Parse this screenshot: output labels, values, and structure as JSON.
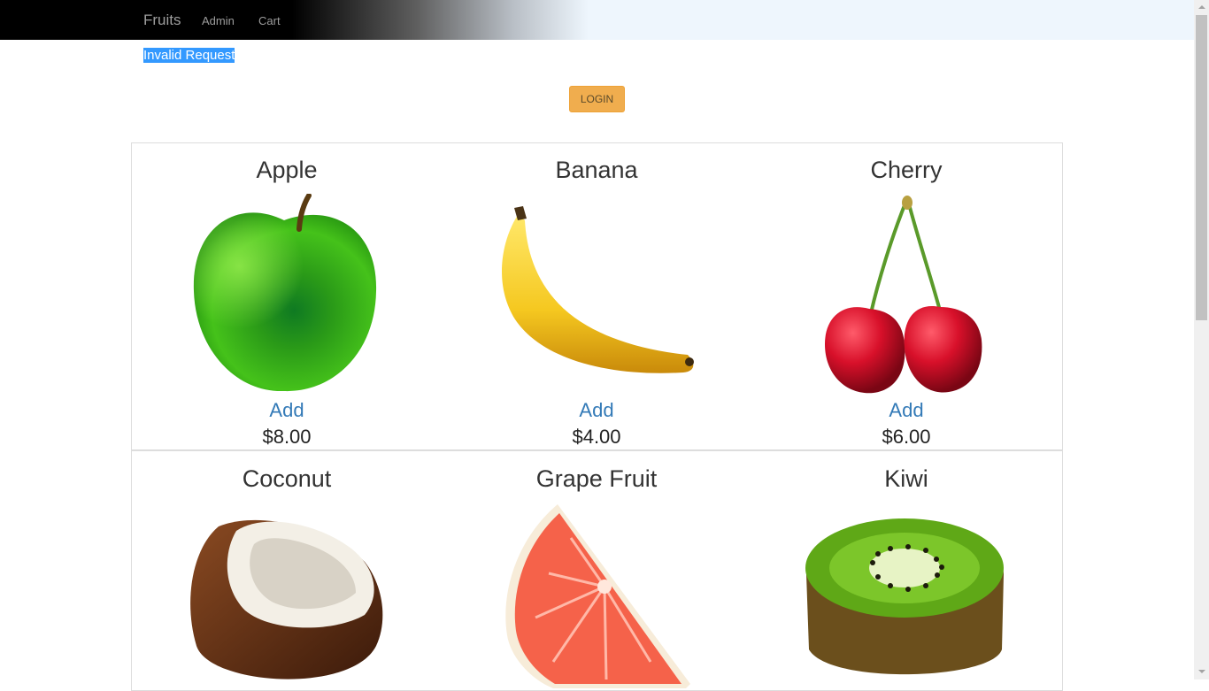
{
  "nav": {
    "brand": "Fruits",
    "links": [
      "Admin",
      "Cart"
    ]
  },
  "alert": {
    "text": "Invalid Request"
  },
  "login": {
    "label": "LOGIN"
  },
  "products": [
    {
      "name": "Apple",
      "add_label": "Add",
      "price": "$8.00",
      "image": "green-apple-image"
    },
    {
      "name": "Banana",
      "add_label": "Add",
      "price": "$4.00",
      "image": "banana-image"
    },
    {
      "name": "Cherry",
      "add_label": "Add",
      "price": "$6.00",
      "image": "cherry-image"
    },
    {
      "name": "Coconut",
      "image": "coconut-image"
    },
    {
      "name": "Grape Fruit",
      "image": "grapefruit-image"
    },
    {
      "name": "Kiwi",
      "image": "kiwi-image"
    }
  ],
  "colors": {
    "link": "#337ab7",
    "button": "#f0ad4e",
    "selection": "#3399ff"
  }
}
